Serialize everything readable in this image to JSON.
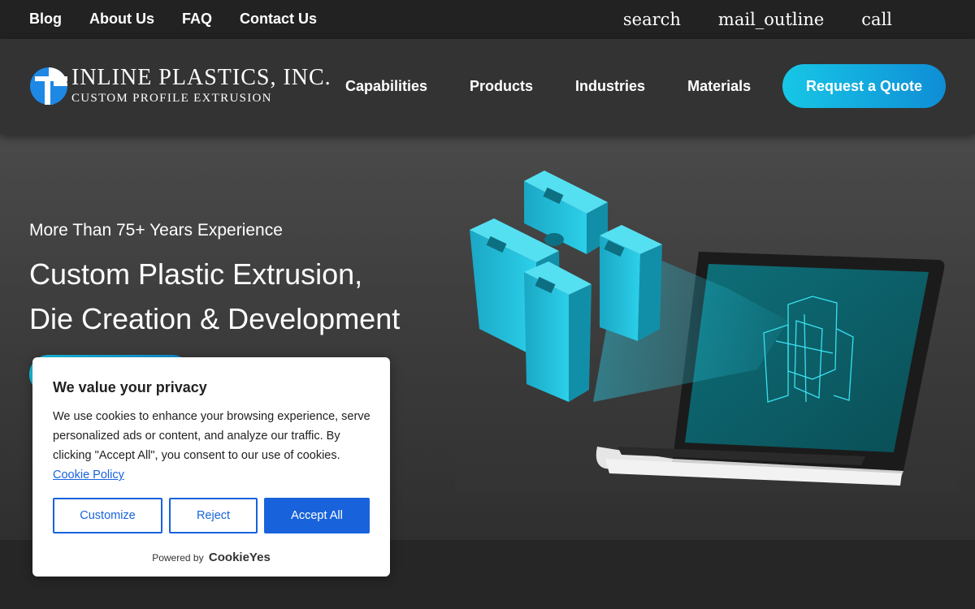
{
  "topbar": {
    "links": [
      "Blog",
      "About Us",
      "FAQ",
      "Contact Us"
    ],
    "icons": [
      "search",
      "mail_outline",
      "call"
    ]
  },
  "logo": {
    "name": "INLINE PLASTICS, INC.",
    "tagline": "CUSTOM PROFILE EXTRUSION"
  },
  "nav": {
    "items": [
      "Capabilities",
      "Products",
      "Industries",
      "Materials"
    ],
    "cta": "Request a Quote"
  },
  "hero": {
    "kicker": "More Than 75+ Years Experience",
    "title_line1": "Custom Plastic Extrusion,",
    "title_line2": "Die Creation & Development"
  },
  "cookie": {
    "title": "We value your privacy",
    "text": "We use cookies to enhance your browsing experience, serve personalized ads or content, and analyze our traffic. By clicking \"Accept All\", you consent to our use of cookies.",
    "policy_link": "Cookie Policy",
    "buttons": {
      "customize": "Customize",
      "reject": "Reject",
      "accept": "Accept All"
    },
    "powered_by": "Powered by",
    "powered_brand": "CookieYes"
  },
  "colors": {
    "accent": "#17c7e6",
    "cookie_primary": "#1863dc"
  }
}
